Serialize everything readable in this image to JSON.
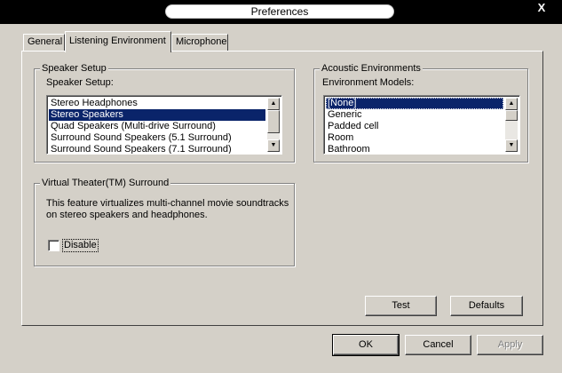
{
  "window": {
    "title": "Preferences",
    "close_glyph": "X"
  },
  "tabs": [
    {
      "label": "General",
      "active": false
    },
    {
      "label": "Listening Environment",
      "active": true
    },
    {
      "label": "Microphone",
      "active": false
    }
  ],
  "speaker_setup": {
    "group_title": "Speaker Setup",
    "list_label": "Speaker Setup:",
    "items": [
      "Stereo Headphones",
      "Stereo Speakers",
      "Quad Speakers (Multi-drive Surround)",
      "Surround Sound Speakers (5.1 Surround)",
      "Surround Sound Speakers (7.1 Surround)"
    ],
    "selected_index": 1
  },
  "acoustic": {
    "group_title": "Acoustic Environments",
    "list_label": "Environment Models:",
    "items": [
      "[None]",
      "Generic",
      "Padded cell",
      "Room",
      "Bathroom"
    ],
    "selected_index": 0
  },
  "virtual_theater": {
    "group_title": "Virtual Theater(TM) Surround",
    "description_line1": "This feature virtualizes multi-channel movie soundtracks",
    "description_line2": "on stereo speakers and headphones.",
    "disable_label": "Disable",
    "disable_checked": false
  },
  "buttons": {
    "test": "Test",
    "defaults": "Defaults",
    "ok": "OK",
    "cancel": "Cancel",
    "apply": "Apply"
  },
  "icons": {
    "scroll_up": "▲",
    "scroll_down": "▼"
  }
}
